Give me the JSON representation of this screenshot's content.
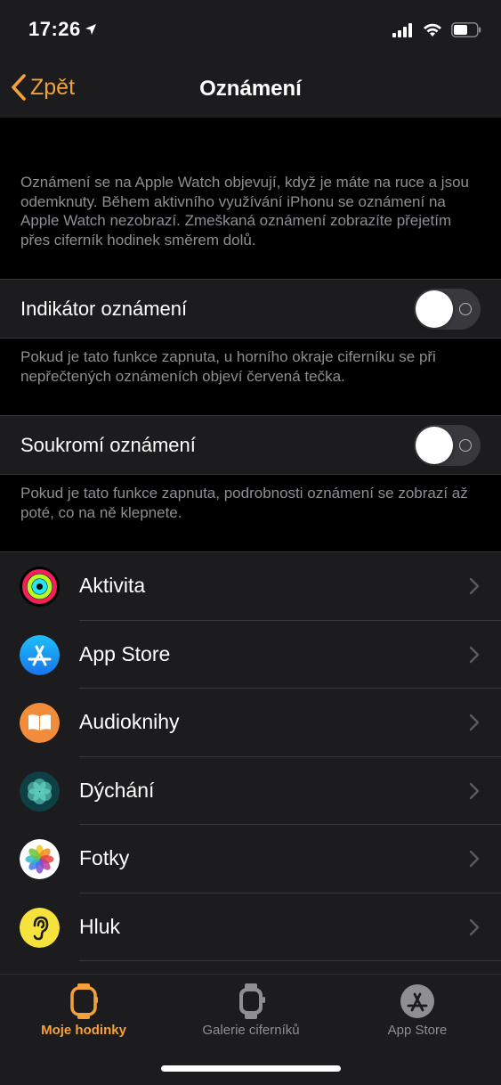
{
  "status_bar": {
    "time": "17:26"
  },
  "nav": {
    "back_label": "Zpět",
    "title": "Oznámení"
  },
  "intro_text": "Oznámení se na Apple Watch objevují, když je máte na ruce a jsou odemknuty. Během aktivního využívání iPhonu se oznámení na Apple Watch nezobrazí. Zmeškaná oznámení zobrazíte přejetím přes ciferník hodinek směrem dolů.",
  "settings": [
    {
      "label": "Indikátor oznámení",
      "enabled": false,
      "footnote": "Pokud je tato funkce zapnuta, u horního okraje ciferníku se při nepřečtených oznámeních objeví červená tečka."
    },
    {
      "label": "Soukromí oznámení",
      "enabled": false,
      "footnote": "Pokud je tato funkce zapnuta, podrobnosti oznámení se zobrazí až poté, co na ně klepnete."
    }
  ],
  "apps": [
    {
      "label": "Aktivita",
      "icon": "activity-rings-icon"
    },
    {
      "label": "App Store",
      "icon": "app-store-icon"
    },
    {
      "label": "Audioknihy",
      "icon": "audiobooks-icon"
    },
    {
      "label": "Dýchání",
      "icon": "breathe-icon"
    },
    {
      "label": "Fotky",
      "icon": "photos-icon"
    },
    {
      "label": "Hluk",
      "icon": "noise-ear-icon"
    }
  ],
  "tabs": [
    {
      "label": "Moje hodinky",
      "icon": "watch-icon",
      "active": true
    },
    {
      "label": "Galerie ciferníků",
      "icon": "watch-face-gallery-icon",
      "active": false
    },
    {
      "label": "App Store",
      "icon": "app-store-tab-icon",
      "active": false
    }
  ],
  "colors": {
    "accent": "#f4a13a",
    "background": "#000000",
    "cell": "#1c1c1e",
    "secondary_text": "#8e8e93"
  }
}
